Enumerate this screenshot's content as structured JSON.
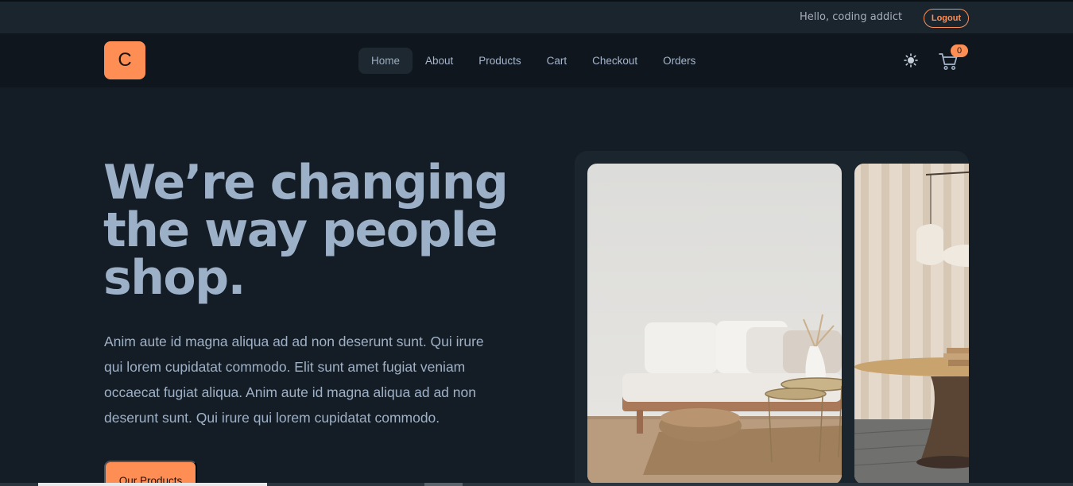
{
  "topbar": {
    "greeting": "Hello, coding addict",
    "logout_label": "Logout"
  },
  "navbar": {
    "logo_letter": "C",
    "links": [
      {
        "label": "Home",
        "active": true
      },
      {
        "label": "About"
      },
      {
        "label": "Products"
      },
      {
        "label": "Cart"
      },
      {
        "label": "Checkout"
      },
      {
        "label": "Orders"
      }
    ],
    "theme_icon": "sun-icon",
    "cart_icon": "cart-icon",
    "cart_count": "0"
  },
  "hero": {
    "title": "We’re changing the way people shop.",
    "text": "Anim aute id magna aliqua ad ad non deserunt sunt. Qui irure qui lorem cupidatat commodo. Elit sunt amet fugiat veniam occaecat fugiat aliqua. Anim aute id magna aliqua ad ad non deserunt sunt. Qui irure qui lorem cupidatat commodo.",
    "cta_label": "Our Products"
  },
  "carousel": {
    "slides": [
      "living-room-sofa-image",
      "round-table-lamps-image"
    ]
  },
  "colors": {
    "accent": "#ff8e55",
    "background": "#141c25",
    "navbar": "#0f161d",
    "topbar": "#1b252e",
    "heading": "#9cb0c8"
  }
}
